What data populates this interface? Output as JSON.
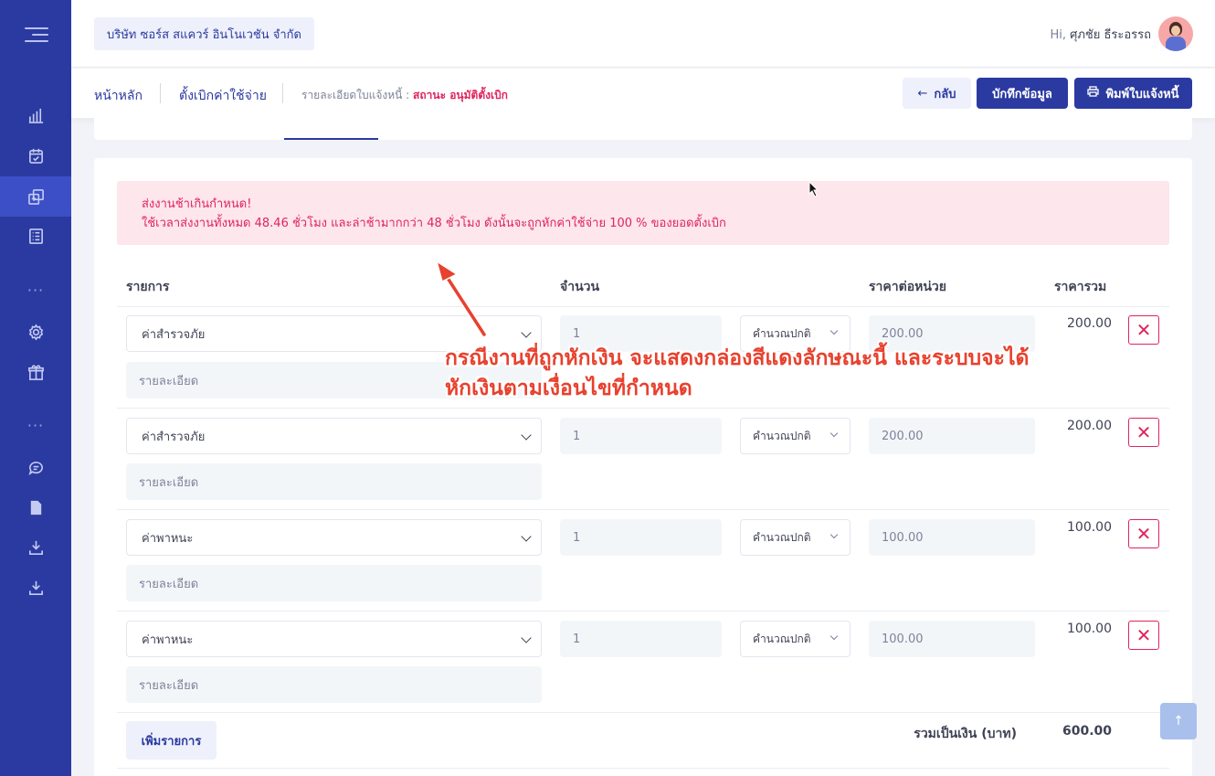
{
  "header": {
    "company": "บริษัท ซอร์ส สแควร์ อินโนเวชัน จำกัด",
    "greeting": "Hi,",
    "user_name": "ศุภชัย ธีระอรรถ"
  },
  "breadcrumb": {
    "home": "หน้าหลัก",
    "section": "ตั้งเบิกค่าใช้จ่าย",
    "detail_label": "รายละเอียดใบแจ้งหนี้ :",
    "status": "สถานะ อนุมัติตั้งเบิก"
  },
  "toolbar": {
    "back_label": "กลับ",
    "save_label": "บักทึกข้อมูล",
    "print_label": "พิมพ์ใบแจ้งหนี้"
  },
  "alert": {
    "title": "ส่งงานช้าเกินกำหนด!",
    "message": "ใช้เวลาส่งงานทั้งหมด 48.46 ชั่วโมง และล่าช้ามากกว่า 48 ชั่วโมง ดังนั้นจะถูกหักค่าใช้จ่าย 100 % ของยอดตั้งเบิก"
  },
  "table": {
    "headers": {
      "item": "รายการ",
      "qty": "จำนวน",
      "unit_price": "ราคาต่อหน่วย",
      "total": "ราคารวม"
    },
    "detail_placeholder": "รายละเอียด",
    "rows": [
      {
        "item": "ค่าสำรวจภัย",
        "qty": "1",
        "calc": "คำนวณปกติ",
        "unit_price": "200.00",
        "total": "200.00"
      },
      {
        "item": "ค่าสำรวจภัย",
        "qty": "1",
        "calc": "คำนวณปกติ",
        "unit_price": "200.00",
        "total": "200.00"
      },
      {
        "item": "ค่าพาหนะ",
        "qty": "1",
        "calc": "คำนวณปกติ",
        "unit_price": "100.00",
        "total": "100.00"
      },
      {
        "item": "ค่าพาหนะ",
        "qty": "1",
        "calc": "คำนวณปกติ",
        "unit_price": "100.00",
        "total": "100.00"
      }
    ],
    "add_label": "เพิ่มรายการ",
    "sum_label": "รวมเป็นเงิน (บาท)",
    "sum_value": "600.00"
  },
  "annotation": {
    "line1": "กรณีงานที่ถูกหักเงิน จะแสดงกล่องสีแดงลักษณะนี้ และระบบจะได้",
    "line2": "หักเงินตามเงื่อนไขที่กำหนด"
  },
  "colors": {
    "sidebar": "#2b3aa0",
    "primary": "#2b3aa0",
    "danger": "#e0245e",
    "alert_bg": "#fde6ec",
    "annotation": "#e8412e"
  },
  "icons": {
    "sidebar": [
      "menu-toggle-icon",
      "chart-icon",
      "calendar-check-icon",
      "copy-icon",
      "list-icon",
      "settings-icon",
      "gift-icon",
      "chat-icon",
      "file-icon",
      "download-icon",
      "download-icon"
    ]
  }
}
